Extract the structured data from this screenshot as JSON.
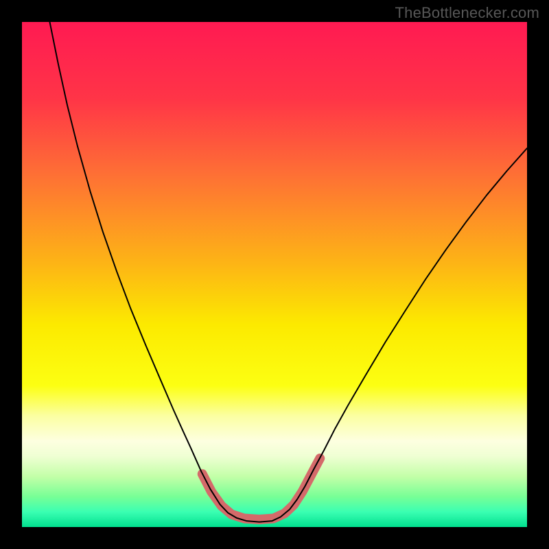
{
  "watermark": "TheBottlenecker.com",
  "chart_data": {
    "type": "line",
    "title": "",
    "xlabel": "",
    "ylabel": "",
    "xlim": [
      0,
      1
    ],
    "ylim": [
      0,
      1
    ],
    "grid": false,
    "legend": false,
    "background": {
      "stops": [
        {
          "y": 0.0,
          "color": "#ff1a52"
        },
        {
          "y": 0.15,
          "color": "#ff3447"
        },
        {
          "y": 0.3,
          "color": "#fe6f35"
        },
        {
          "y": 0.48,
          "color": "#fdb515"
        },
        {
          "y": 0.6,
          "color": "#fcea00"
        },
        {
          "y": 0.72,
          "color": "#fcff12"
        },
        {
          "y": 0.78,
          "color": "#fbffa2"
        },
        {
          "y": 0.83,
          "color": "#fdffe0"
        },
        {
          "y": 0.86,
          "color": "#efffd3"
        },
        {
          "y": 0.9,
          "color": "#c3ffa8"
        },
        {
          "y": 0.94,
          "color": "#77ff96"
        },
        {
          "y": 0.97,
          "color": "#3affb2"
        },
        {
          "y": 1.0,
          "color": "#01e08f"
        }
      ]
    },
    "series": [
      {
        "name": "left-curve",
        "stroke": "#000000",
        "stroke_width": 2,
        "points": [
          {
            "x": 0.055,
            "y": 0.0
          },
          {
            "x": 0.072,
            "y": 0.084
          },
          {
            "x": 0.09,
            "y": 0.166
          },
          {
            "x": 0.11,
            "y": 0.246
          },
          {
            "x": 0.135,
            "y": 0.335
          },
          {
            "x": 0.16,
            "y": 0.415
          },
          {
            "x": 0.188,
            "y": 0.495
          },
          {
            "x": 0.215,
            "y": 0.567
          },
          {
            "x": 0.245,
            "y": 0.64
          },
          {
            "x": 0.275,
            "y": 0.71
          },
          {
            "x": 0.3,
            "y": 0.768
          },
          {
            "x": 0.318,
            "y": 0.808
          },
          {
            "x": 0.335,
            "y": 0.845
          },
          {
            "x": 0.355,
            "y": 0.89
          },
          {
            "x": 0.373,
            "y": 0.925
          },
          {
            "x": 0.392,
            "y": 0.955
          },
          {
            "x": 0.408,
            "y": 0.972
          },
          {
            "x": 0.425,
            "y": 0.982
          },
          {
            "x": 0.445,
            "y": 0.988
          },
          {
            "x": 0.47,
            "y": 0.99
          },
          {
            "x": 0.495,
            "y": 0.988
          },
          {
            "x": 0.512,
            "y": 0.98
          },
          {
            "x": 0.53,
            "y": 0.965
          },
          {
            "x": 0.545,
            "y": 0.945
          },
          {
            "x": 0.56,
            "y": 0.92
          },
          {
            "x": 0.578,
            "y": 0.885
          },
          {
            "x": 0.598,
            "y": 0.848
          },
          {
            "x": 0.62,
            "y": 0.805
          },
          {
            "x": 0.645,
            "y": 0.76
          },
          {
            "x": 0.68,
            "y": 0.7
          },
          {
            "x": 0.72,
            "y": 0.633
          },
          {
            "x": 0.76,
            "y": 0.57
          },
          {
            "x": 0.8,
            "y": 0.508
          },
          {
            "x": 0.84,
            "y": 0.45
          },
          {
            "x": 0.88,
            "y": 0.395
          },
          {
            "x": 0.92,
            "y": 0.343
          },
          {
            "x": 0.96,
            "y": 0.295
          },
          {
            "x": 1.0,
            "y": 0.25
          }
        ]
      },
      {
        "name": "bottom-highlight",
        "stroke": "#d46a6a",
        "stroke_width": 14,
        "points": [
          {
            "x": 0.357,
            "y": 0.895
          },
          {
            "x": 0.375,
            "y": 0.93
          },
          {
            "x": 0.395,
            "y": 0.958
          },
          {
            "x": 0.415,
            "y": 0.975
          },
          {
            "x": 0.44,
            "y": 0.983
          },
          {
            "x": 0.47,
            "y": 0.985
          },
          {
            "x": 0.498,
            "y": 0.983
          },
          {
            "x": 0.52,
            "y": 0.973
          },
          {
            "x": 0.538,
            "y": 0.956
          },
          {
            "x": 0.555,
            "y": 0.93
          },
          {
            "x": 0.573,
            "y": 0.896
          },
          {
            "x": 0.59,
            "y": 0.864
          }
        ]
      }
    ]
  }
}
